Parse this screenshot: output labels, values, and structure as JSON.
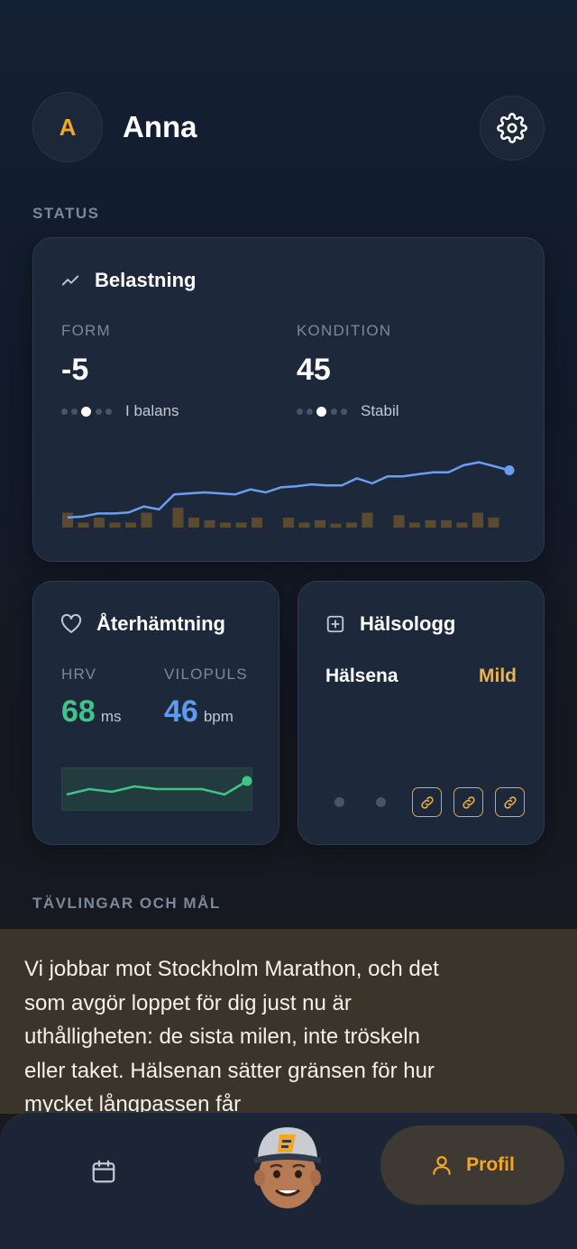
{
  "user": {
    "initial": "A",
    "name": "Anna"
  },
  "sections": {
    "status": "STATUS",
    "goals": "TÄVLINGAR OCH MÅL"
  },
  "load_card": {
    "title": "Belastning",
    "form": {
      "label": "FORM",
      "value": "-5",
      "caption": "I balans",
      "dot_active_index": 2
    },
    "condition": {
      "label": "KONDITION",
      "value": "45",
      "caption": "Stabil",
      "dot_active_index": 2
    },
    "line_color": "#6b9ef0",
    "bar_color": "#5a4a30"
  },
  "chart_data": {
    "type": "line",
    "series": [
      {
        "values": [
          10,
          11,
          14,
          14,
          15,
          21,
          18,
          33,
          34,
          35,
          34,
          33,
          38,
          35,
          40,
          41,
          43,
          42,
          42,
          49,
          44,
          51,
          51,
          53,
          55,
          55,
          62,
          65,
          61,
          57
        ]
      }
    ],
    "bars": [
      3,
      1,
      2,
      1,
      1,
      3,
      0,
      4,
      2,
      1.5,
      1,
      1,
      2,
      0,
      2,
      1,
      1.5,
      0.8,
      1,
      3,
      0,
      2.5,
      1,
      1.5,
      1.5,
      1,
      3,
      2
    ]
  },
  "recovery_card": {
    "title": "Återhämtning",
    "hrv": {
      "label": "HRV",
      "value": "68",
      "unit": "ms",
      "color": "#3fc48a"
    },
    "resting_hr": {
      "label": "VILOPULS",
      "value": "46",
      "unit": "bpm",
      "color": "#5c9bf0"
    },
    "sparkline": [
      4,
      6,
      5,
      7,
      6,
      6,
      6,
      4,
      9
    ]
  },
  "health_card": {
    "title": "Hälsologg",
    "item": "Hälsena",
    "severity": "Mild",
    "severity_color": "#e6b45a"
  },
  "coach_message": "Vi jobbar mot Stockholm Marathon, och det som avgör loppet för dig just nu är uthålligheten: de sista milen, inte tröskeln eller taket. Hälsenan sätter gränsen för hur mycket långpassen får",
  "nav": {
    "profile_label": "Profil",
    "accent": "#f5a623"
  }
}
